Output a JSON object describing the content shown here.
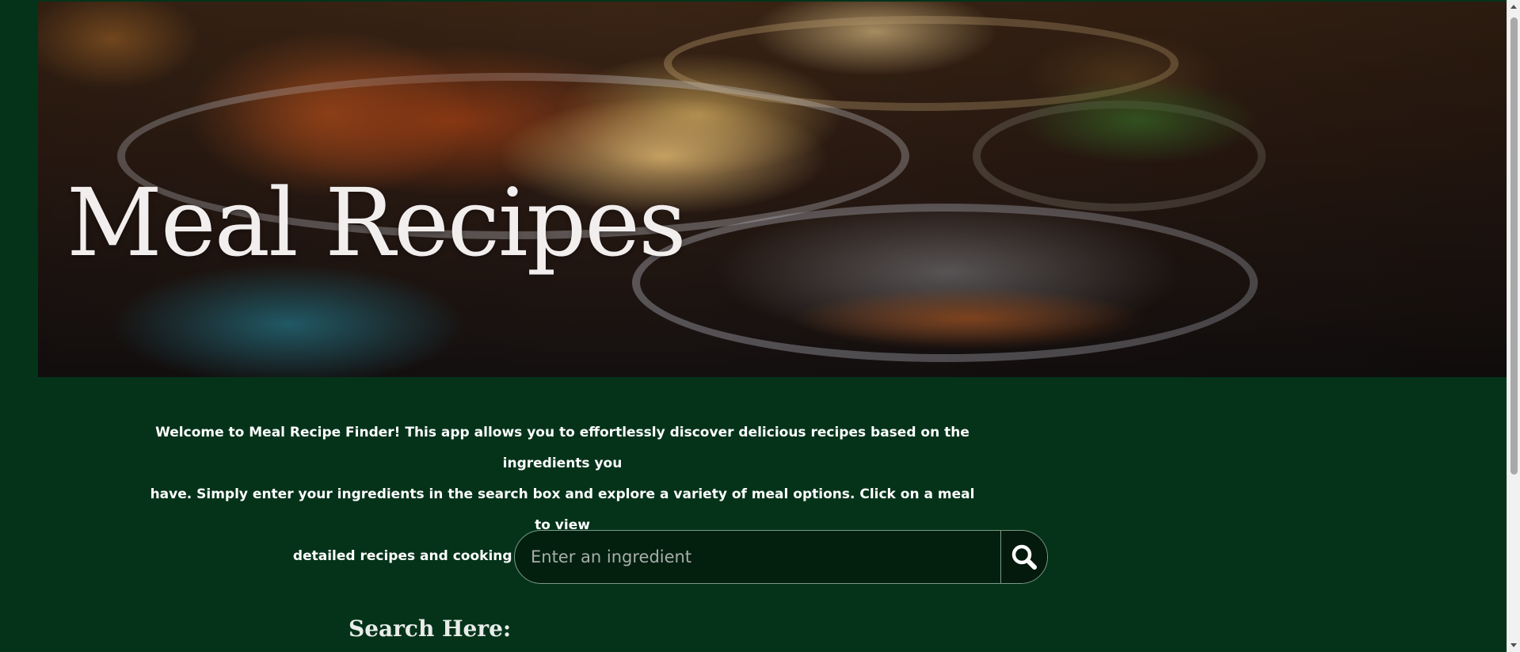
{
  "hero": {
    "title": "Meal Recipes"
  },
  "intro": {
    "lines": [
      "Welcome to Meal Recipe Finder! This app allows you to effortlessly discover delicious recipes based on the ingredients you",
      "have. Simply enter your ingredients in the search box and explore a variety of meal options. Click on a meal to view",
      "detailed recipes and cooking instructions. Enjoy your culinary journey!"
    ]
  },
  "search": {
    "placeholder": "Enter an ingredient",
    "value": "",
    "button_icon": "search-icon"
  },
  "results": {
    "heading": "Search Here:"
  },
  "colors": {
    "background": "#05331a",
    "search_bg": "#03200f",
    "text": "#ffffff"
  }
}
